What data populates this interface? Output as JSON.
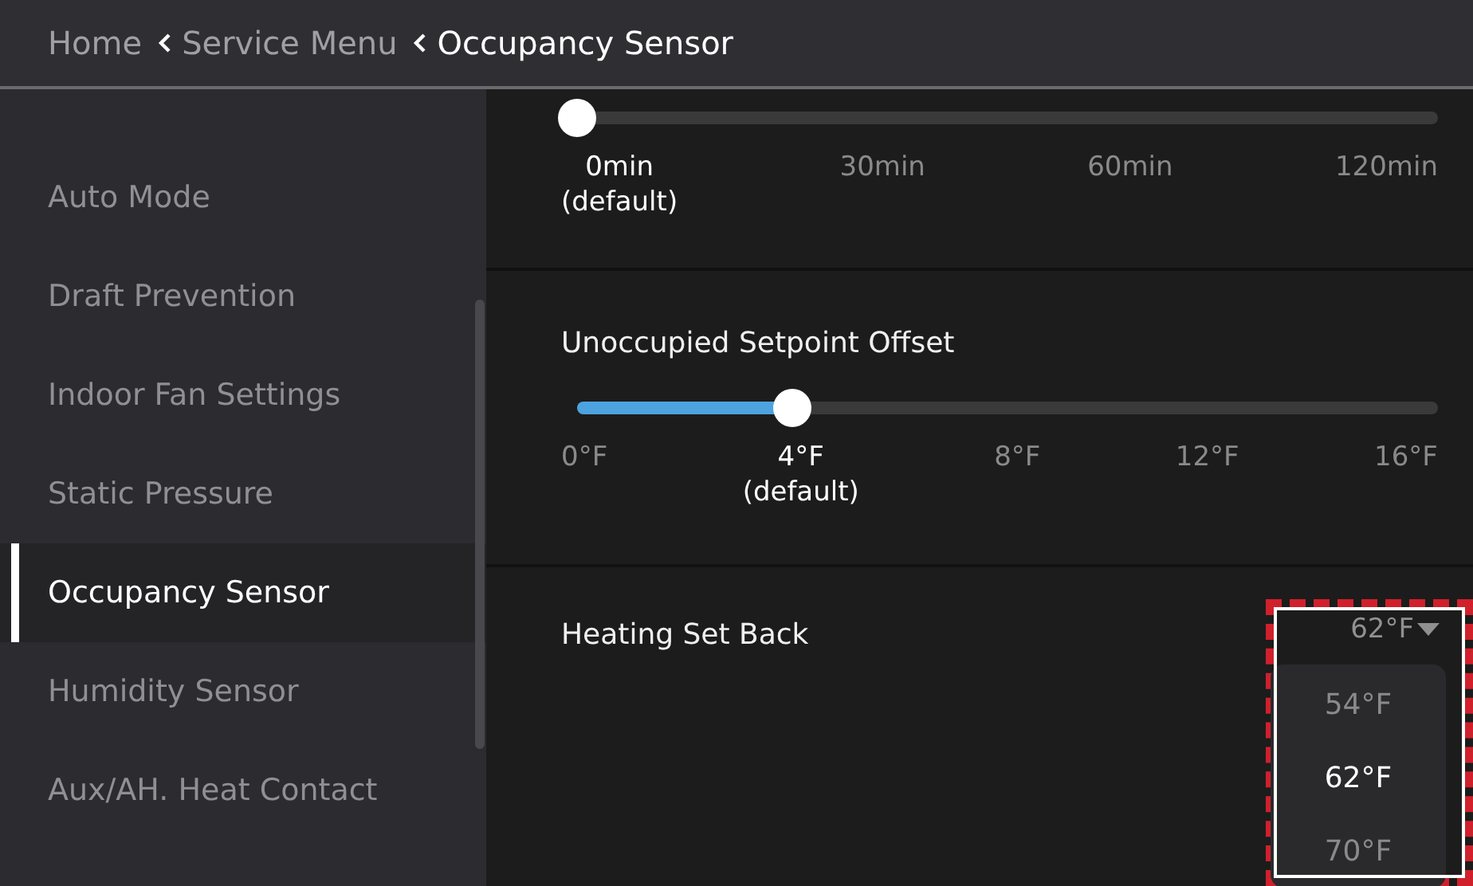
{
  "breadcrumb": [
    {
      "label": "Home",
      "current": false
    },
    {
      "label": "Service Menu",
      "current": false
    },
    {
      "label": "Occupancy Sensor",
      "current": true
    }
  ],
  "sidebar": {
    "items": [
      {
        "label": "Auto Mode",
        "selected": false
      },
      {
        "label": "Draft Prevention",
        "selected": false
      },
      {
        "label": "Indoor Fan Settings",
        "selected": false
      },
      {
        "label": "Static Pressure",
        "selected": false
      },
      {
        "label": "Occupancy Sensor",
        "selected": true
      },
      {
        "label": "Humidity Sensor",
        "selected": false
      },
      {
        "label": "Aux/AH. Heat Contact",
        "selected": false
      }
    ]
  },
  "settings": [
    {
      "kind": "slider",
      "level": 0,
      "ticks": [
        {
          "label": "0min",
          "note": "(default)",
          "selected": true
        },
        {
          "label": "30min",
          "selected": false
        },
        {
          "label": "60min",
          "selected": false
        },
        {
          "label": "120min",
          "selected": false
        }
      ]
    },
    {
      "kind": "slider",
      "title": "Unoccupied Setpoint Offset",
      "level": 0.25,
      "ticks": [
        {
          "label": "0°F",
          "selected": false
        },
        {
          "label": "4°F",
          "note": "(default)",
          "selected": true
        },
        {
          "label": "8°F",
          "selected": false
        },
        {
          "label": "12°F",
          "selected": false
        },
        {
          "label": "16°F",
          "selected": false
        }
      ]
    },
    {
      "kind": "dropdown",
      "title": "Heating Set Back",
      "value": "62°F",
      "expanded": true,
      "highlighted": true,
      "options": [
        {
          "label": "54°F",
          "selected": false
        },
        {
          "label": "62°F",
          "selected": true
        },
        {
          "label": "70°F",
          "selected": false
        }
      ]
    }
  ]
}
